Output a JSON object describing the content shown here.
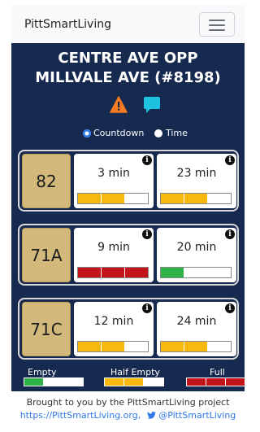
{
  "nav": {
    "brand": "PittSmartLiving"
  },
  "stop": {
    "line1": "CENTRE AVE OPP",
    "line2": "MILLVALE AVE (#8198)"
  },
  "icons": {
    "warning": "warning-icon",
    "message": "chat-bubble-icon"
  },
  "mode": {
    "countdown_label": "Countdown",
    "time_label": "Time",
    "selected": "Countdown"
  },
  "routes": [
    {
      "route": "82",
      "predictions": [
        {
          "time": "3 min",
          "fullness": "half",
          "level": 0.67,
          "info": "i"
        },
        {
          "time": "23 min",
          "fullness": "half",
          "level": 0.67,
          "info": "i"
        }
      ]
    },
    {
      "route": "71A",
      "predictions": [
        {
          "time": "9 min",
          "fullness": "full",
          "level": 1.0,
          "info": "i"
        },
        {
          "time": "20 min",
          "fullness": "empty",
          "level": 0.33,
          "info": "i"
        }
      ]
    },
    {
      "route": "71C",
      "predictions": [
        {
          "time": "12 min",
          "fullness": "half",
          "level": 0.67,
          "info": "i"
        },
        {
          "time": "24 min",
          "fullness": "half",
          "level": 0.67,
          "info": "i"
        }
      ]
    }
  ],
  "legend": {
    "empty": "Empty",
    "half": "Half Empty",
    "full": "Full"
  },
  "colors": {
    "panel": "#16294f",
    "route_bg": "#d2b97b",
    "empty": "#2fb346",
    "half": "#f8b90f",
    "full": "#c3141b",
    "warning": "#f47b20",
    "message": "#1fc1e0"
  },
  "footer": {
    "credit": "Brought to you by the PittSmartLiving project",
    "site": "https://PittSmartLiving.org,",
    "twitter": "@PittSmartLiving"
  }
}
